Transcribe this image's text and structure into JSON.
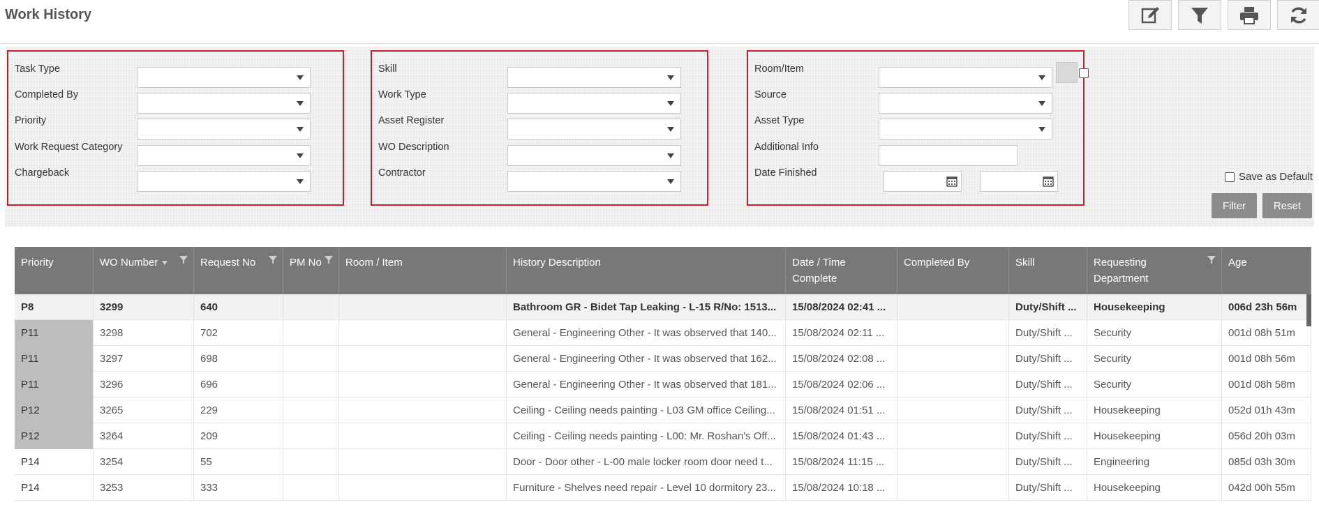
{
  "page_title": "Work History",
  "toolbar": [
    {
      "name": "edit-button",
      "icon": "pencil-icon"
    },
    {
      "name": "filter-toggle-button",
      "icon": "funnel-icon"
    },
    {
      "name": "print-button",
      "icon": "printer-icon"
    },
    {
      "name": "refresh-button",
      "icon": "refresh-icon"
    }
  ],
  "filters": {
    "group1": [
      {
        "label": "Task Type",
        "value": ""
      },
      {
        "label": "Completed By",
        "value": ""
      },
      {
        "label": "Priority",
        "value": ""
      },
      {
        "label": "Work Request Category",
        "value": ""
      },
      {
        "label": "Chargeback",
        "value": ""
      }
    ],
    "group2": [
      {
        "label": "Skill",
        "value": ""
      },
      {
        "label": "Work Type",
        "value": ""
      },
      {
        "label": "Asset Register",
        "value": ""
      },
      {
        "label": "WO Description",
        "value": ""
      },
      {
        "label": "Contractor",
        "value": ""
      }
    ],
    "group3": {
      "room_item": {
        "label": "Room/Item",
        "value": ""
      },
      "source": {
        "label": "Source",
        "value": ""
      },
      "asset_type": {
        "label": "Asset Type",
        "value": ""
      },
      "additional_info": {
        "label": "Additional Info",
        "value": ""
      },
      "date_finished": {
        "label": "Date Finished",
        "from": "",
        "to": ""
      }
    },
    "save_as_default": "Save as Default",
    "filter_label": "Filter",
    "reset_label": "Reset"
  },
  "colors": {
    "accent_border": "#c41f2c",
    "header_bg": "#787878",
    "button_bg": "#8c8c8c"
  },
  "table": {
    "columns": [
      "Priority",
      "WO Number",
      "Request No",
      "PM No",
      "Room / Item",
      "History Description",
      "Date / Time Complete",
      "Completed By",
      "Skill",
      "Requesting Department",
      "Age"
    ],
    "rows": [
      [
        "P8",
        "3299",
        "640",
        "",
        "",
        "Bathroom GR - Bidet Tap Leaking - L-15 R/No: 1513...",
        "15/08/2024 02:41 ...",
        "",
        "Duty/Shift ...",
        "Housekeeping",
        "006d 23h 56m"
      ],
      [
        "P11",
        "3298",
        "702",
        "",
        "",
        "General - Engineering Other - It was observed that 140...",
        "15/08/2024 02:11 ...",
        "",
        "Duty/Shift ...",
        "Security",
        "001d 08h 51m"
      ],
      [
        "P11",
        "3297",
        "698",
        "",
        "",
        "General - Engineering Other - It was observed that 162...",
        "15/08/2024 02:08 ...",
        "",
        "Duty/Shift ...",
        "Security",
        "001d 08h 56m"
      ],
      [
        "P11",
        "3296",
        "696",
        "",
        "",
        "General - Engineering Other - It was observed that 181...",
        "15/08/2024 02:06 ...",
        "",
        "Duty/Shift ...",
        "Security",
        "001d 08h 58m"
      ],
      [
        "P12",
        "3265",
        "229",
        "",
        "",
        "Ceiling - Ceiling needs painting - L03 GM office Ceiling...",
        "15/08/2024 01:51 ...",
        "",
        "Duty/Shift ...",
        "Housekeeping",
        "052d 01h 43m"
      ],
      [
        "P12",
        "3264",
        "209",
        "",
        "",
        "Ceiling - Ceiling needs painting - L00: Mr. Roshan's Off...",
        "15/08/2024 01:43 ...",
        "",
        "Duty/Shift ...",
        "Housekeeping",
        "056d 20h 03m"
      ],
      [
        "P14",
        "3254",
        "55",
        "",
        "",
        "Door - Door other - L-00 male locker room door need t...",
        "15/08/2024 11:15 ...",
        "",
        "Duty/Shift ...",
        "Engineering",
        "085d 03h 30m"
      ],
      [
        "P14",
        "3253",
        "333",
        "",
        "",
        "Furniture - Shelves need repair - Level 10 dormitory 23...",
        "15/08/2024 10:18 ...",
        "",
        "Duty/Shift ...",
        "Housekeeping",
        "042d 00h 55m"
      ]
    ]
  }
}
